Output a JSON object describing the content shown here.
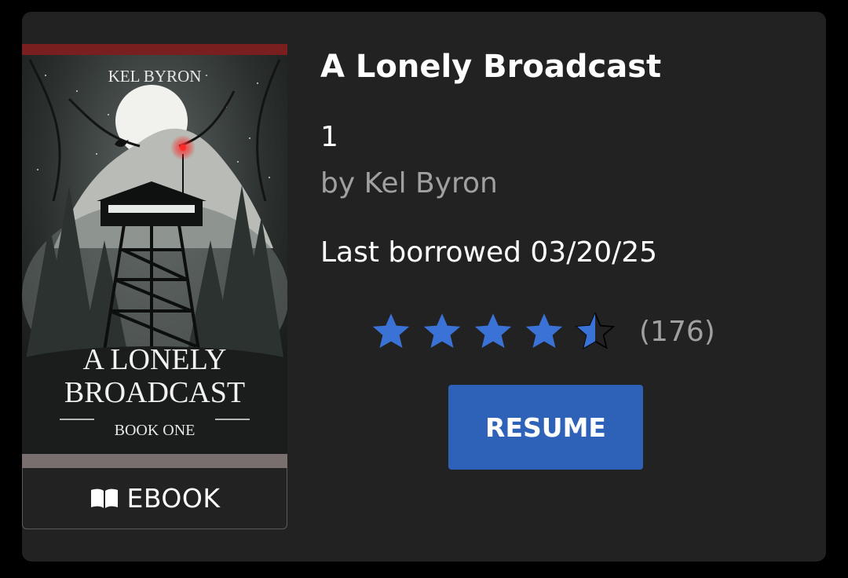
{
  "book": {
    "title": "A Lonely Broadcast",
    "series_number": "1",
    "author_line": "by Kel Byron",
    "last_borrowed": "Last borrowed 03/20/25",
    "format_label": "EBOOK",
    "format_icon": "open-book-icon"
  },
  "cover": {
    "author": "KEL BYRON",
    "title_line1": "A LONELY",
    "title_line2": "BROADCAST",
    "subtitle": "BOOK ONE"
  },
  "rating": {
    "value": 4.5,
    "max": 5,
    "count_label": "(176)",
    "star_color": "#3a72d6",
    "empty_star_icon": "star-outline-icon",
    "full_star_icon": "star-filled-icon"
  },
  "actions": {
    "resume_label": "RESUME"
  },
  "colors": {
    "card_bg": "#222222",
    "page_bg": "#000000",
    "button_bg": "#2d62b8",
    "muted_text": "#a0a0a0",
    "cover_top_band": "#7a1f1f"
  }
}
